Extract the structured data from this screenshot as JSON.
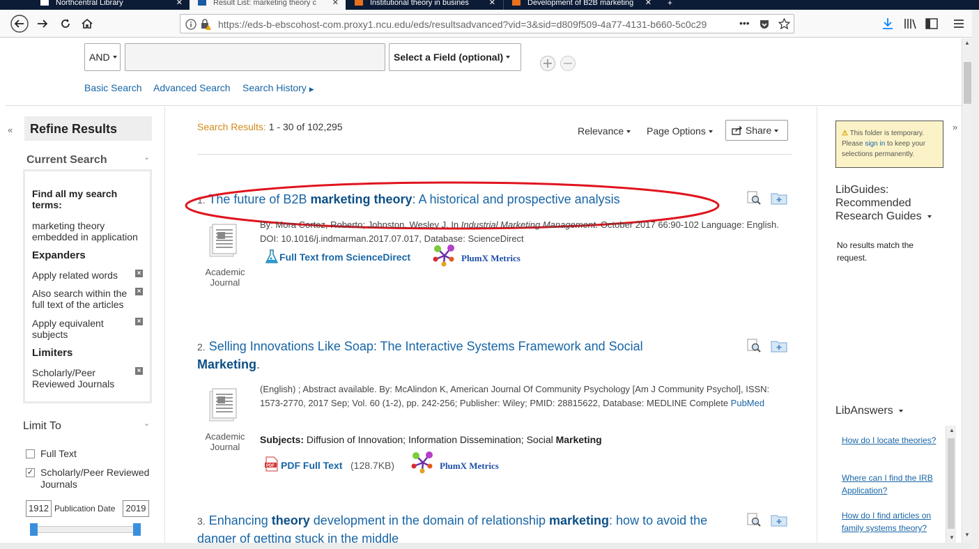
{
  "browser": {
    "tabs": [
      {
        "label": "Northcentral Library",
        "active": false
      },
      {
        "label": "Result List: marketing theory c",
        "active": true
      },
      {
        "label": "Institutional theory in busines",
        "active": false
      },
      {
        "label": "Development of B2B marketing",
        "active": false
      }
    ],
    "url": "https://eds-b-ebscohost-com.proxy1.ncu.edu/eds/resultsadvanced?vid=3&sid=d809f509-4a77-4131-b660-5c0c29",
    "url_more": "•••"
  },
  "search": {
    "bool_operator": "AND",
    "field_select": "Select a Field (optional)",
    "links": {
      "basic": "Basic Search",
      "advanced": "Advanced Search",
      "history": "Search History"
    }
  },
  "refine": {
    "title": "Refine Results",
    "current_search": "Current Search",
    "find_all": "Find all my search terms:",
    "query": "marketing theory embedded in application",
    "expanders_h": "Expanders",
    "expanders": [
      "Apply related words",
      "Also search within the full text of the articles",
      "Apply equivalent subjects"
    ],
    "limiters_h": "Limiters",
    "limiters": [
      "Scholarly/Peer Reviewed Journals"
    ],
    "limit_to": "Limit To",
    "full_text": "Full Text",
    "scholarly": "Scholarly/Peer Reviewed Journals",
    "pub_date_label": "Publication Date",
    "date_from": "1912",
    "date_to": "2019"
  },
  "results": {
    "summary_label": "Search Results:",
    "summary_range": "1 - 30 of 102,295",
    "relevance": "Relevance",
    "page_options": "Page Options",
    "share": "Share",
    "items": [
      {
        "num": "1.",
        "title_pre": "The future of B2B ",
        "title_bold": "marketing theory",
        "title_post": ": A historical and prospective analysis",
        "meta_1": "By: Mora Cortez, Roberto; Johnston, Wesley J. In ",
        "meta_journal": "Industrial Marketing Management.",
        "meta_2": " October 2017 66:90-102 Language: English. DOI: 10.1016/j.indmarman.2017.07.017, Database: ScienceDirect",
        "doctype": "Academic Journal",
        "fulltext": "Full Text from ScienceDirect",
        "plumx": "PlumX Metrics"
      },
      {
        "num": "2.",
        "title_pre": "Selling Innovations Like Soap: The Interactive Systems Framework and Social ",
        "title_bold": "Marketing",
        "title_post": ".",
        "meta_1": "(English) ; Abstract available. By: McAlindon K, American Journal Of Community Psychology [Am J Community Psychol], ISSN: 1573-2770, 2017 Sep; Vol. 60 (1-2), pp. 242-256; Publisher: Wiley; PMID: 28815622, Database: MEDLINE Complete ",
        "meta_link": "PubMed",
        "subjects_label": "Subjects:",
        "subjects": " Diffusion of Innovation; Information Dissemination; Social ",
        "subjects_bold": "Marketing",
        "doctype": "Academic Journal",
        "pdf": "PDF Full Text",
        "pdf_size": "(128.7KB)",
        "plumx": "PlumX Metrics"
      },
      {
        "num": "3.",
        "title_a": "Enhancing ",
        "title_b1": "theory",
        "title_c": " development in the domain of relationship ",
        "title_b2": "marketing",
        "title_d": ": how to avoid the danger of getting stuck in the middle"
      }
    ]
  },
  "right": {
    "folder_notice_1": "This folder is temporary. Please ",
    "folder_signin": "sign in",
    "folder_notice_2": " to keep your selections permanently.",
    "libguides": "LibGuides: Recommended Research Guides",
    "no_results": "No results match the request.",
    "libanswers": "LibAnswers",
    "faq": [
      "How do I locate theories?",
      "Where can I find the IRB Application?",
      "How do I find articles on family systems theory?"
    ]
  },
  "colors": {
    "link": "#1865a6",
    "annotation": "#e0141e",
    "tabbar": "#0c1b36"
  }
}
